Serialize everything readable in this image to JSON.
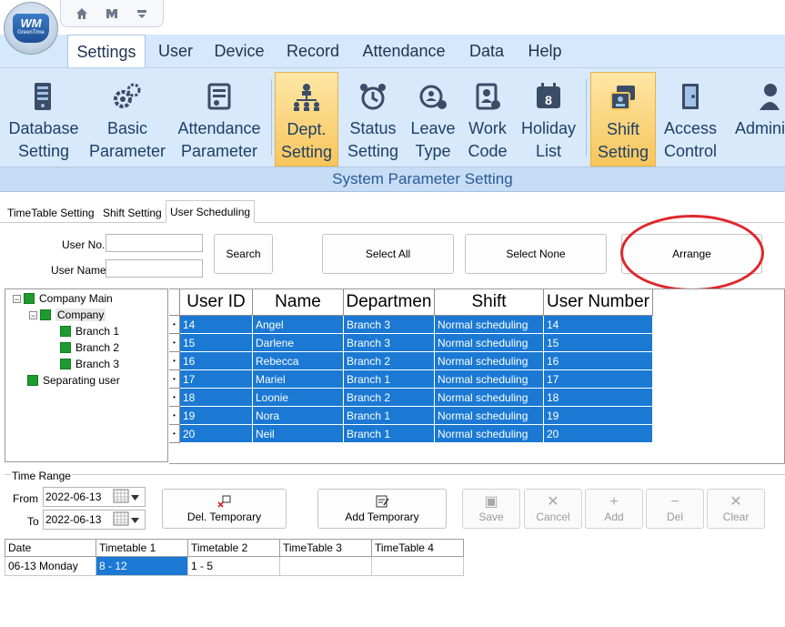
{
  "app": {
    "logo_text": "WM",
    "logo_sub": "GreenTime"
  },
  "quick_access": [
    {
      "icon": "home-icon"
    },
    {
      "icon": "tools-icon"
    },
    {
      "icon": "dropdown-icon"
    }
  ],
  "menu_tabs": [
    "Settings",
    "User",
    "Device",
    "Record",
    "Attendance",
    "Data",
    "Help"
  ],
  "ribbon": {
    "buttons": [
      {
        "label": "Database\nSetting",
        "icon": "database-icon"
      },
      {
        "label": "Basic\nParameter",
        "icon": "gears-icon"
      },
      {
        "label": "Attendance\nParameter",
        "icon": "attendance-param-icon"
      },
      {
        "label": "Dept.\nSetting",
        "icon": "org-chart-icon",
        "selected": true
      },
      {
        "label": "Status\nSetting",
        "icon": "alarm-clock-icon"
      },
      {
        "label": "Leave\nType",
        "icon": "leave-clock-icon"
      },
      {
        "label": "Work\nCode",
        "icon": "work-code-icon"
      },
      {
        "label": "Holiday\nList",
        "icon": "calendar-icon"
      },
      {
        "label": "Shift\nSetting",
        "icon": "shift-icon",
        "selected": true
      },
      {
        "label": "Access\nControl",
        "icon": "door-icon"
      },
      {
        "label": "Adminis",
        "icon": "admin-user-icon"
      }
    ],
    "group_label": "System Parameter Setting"
  },
  "sub_tabs": [
    "TimeTable Setting",
    "Shift Setting",
    "User Scheduling"
  ],
  "search": {
    "user_no_label": "User No.",
    "user_name_label": "User Name",
    "user_no_value": "",
    "user_name_value": "",
    "search_btn": "Search",
    "select_all_btn": "Select All",
    "select_none_btn": "Select None",
    "arrange_btn": "Arrange"
  },
  "tree": {
    "nodes": [
      "Company Main",
      "Company",
      "Branch 1",
      "Branch 2",
      "Branch 3",
      "Separating user"
    ]
  },
  "grid": {
    "columns": [
      "User ID",
      "Name",
      "Departmen",
      "Shift",
      "User Number"
    ],
    "rows": [
      [
        "14",
        "Angel",
        "Branch 3",
        "Normal scheduling",
        "14"
      ],
      [
        "15",
        "Darlene",
        "Branch 3",
        "Normal scheduling",
        "15"
      ],
      [
        "16",
        "Rebecca",
        "Branch 2",
        "Normal scheduling",
        "16"
      ],
      [
        "17",
        "Mariel",
        "Branch 1",
        "Normal scheduling",
        "17"
      ],
      [
        "18",
        "Loonie",
        "Branch 2",
        "Normal scheduling",
        "18"
      ],
      [
        "19",
        "Nora",
        "Branch 1",
        "Normal scheduling",
        "19"
      ],
      [
        "20",
        "Neil",
        "Branch 1",
        "Normal scheduling",
        "20"
      ]
    ]
  },
  "time_range": {
    "title": "Time Range",
    "from_label": "From",
    "to_label": "To",
    "from_value": "2022-06-13",
    "to_value": "2022-06-13",
    "del_temporary": "Del. Temporary",
    "add_temporary": "Add Temporary",
    "save": "Save",
    "cancel": "Cancel",
    "add": "Add",
    "del": "Del",
    "clear": "Clear"
  },
  "schedule_table": {
    "columns": [
      "Date",
      "Timetable 1",
      "Timetable 2",
      "TimeTable 3",
      "TimeTable 4"
    ],
    "row": [
      "06-13 Monday",
      "8 - 12",
      "1 - 5",
      "",
      ""
    ]
  },
  "colors": {
    "selection": "#1b79d4",
    "ribbon": "#d7e9fb",
    "annotation": "#e0272c",
    "active_button": "#f8c55c"
  }
}
